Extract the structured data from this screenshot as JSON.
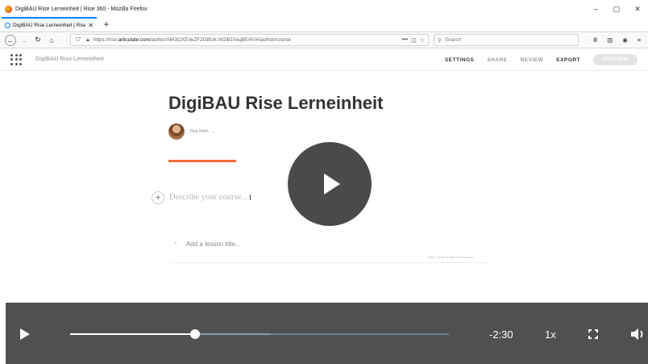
{
  "window": {
    "title": "DigiBAU Rise Lerneinheit | Rise 360 - Mozilla Firefox",
    "minimize": "–",
    "maximize": "▢",
    "close": "✕"
  },
  "browser": {
    "tab_title": "DigiBAU Rise Lerneinheit | Rise",
    "tab_close": "✕",
    "new_tab": "+",
    "url_prefix": "https://rise.",
    "url_domain": "articulate.com",
    "url_path": "/author/NH3t2XEnkZFZGBIzk-W2l8JXeq8Er4V#/author/course",
    "url_more": "•••",
    "search_placeholder": "Search"
  },
  "app": {
    "course_name": "DigiBAU Rise Lerneinheit",
    "menu": {
      "settings": "SETTINGS",
      "share": "SHARE",
      "review": "REVIEW",
      "export": "EXPORT",
      "preview": "PREVIEW"
    }
  },
  "course": {
    "title": "DigiBAU Rise Lerneinheit",
    "author": "Tina Roth",
    "describe_placeholder": "Describe your course...",
    "add_symbol": "+",
    "lesson_placeholder": "Add a lesson title...",
    "lesson_hint": "Shift + Enter to add as a section"
  },
  "player": {
    "time_remaining": "-2:30",
    "speed": "1x",
    "progress_played_fraction": 0.33,
    "progress_buffered_fraction": 0.53
  },
  "colors": {
    "accent_orange": "#f26c3a",
    "firefox_blue": "#0a84ff",
    "control_bar": "#505050",
    "play_circle": "#4a4a4a"
  }
}
